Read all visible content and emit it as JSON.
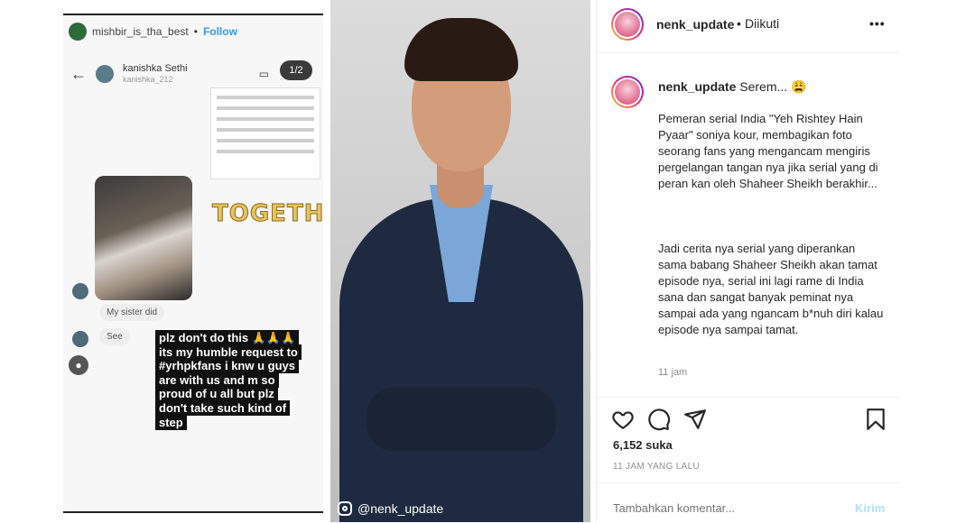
{
  "story": {
    "username": "mishbir_is_tha_best",
    "follow": "Follow",
    "dm_name": "kanishka Sethi",
    "dm_handle": "kanishka_212",
    "pager": "1/2",
    "sticker": "TOGETHER",
    "bubble1": "My sister did",
    "bubble2": "See",
    "caption": [
      "plz don't do this 🙏🙏🙏",
      "its my humble request to",
      "#yrhpkfans i knw u guys",
      "are with us and m so",
      "proud of u all but plz",
      "don't take such kind of",
      "step"
    ]
  },
  "watermark": "@nenk_update",
  "post": {
    "author": "nenk_update",
    "following": "Diikuti",
    "more": "•••",
    "caption_user": "nenk_update",
    "caption_head": "Serem... 😩",
    "paragraph1": "Pemeran serial India \"Yeh Rishtey Hain Pyaar\" soniya kour, membagikan foto seorang fans yang mengancam mengiris pergelangan tangan nya jika serial yang di peran kan oleh Shaheer Sheikh berakhir...",
    "paragraph2": "Jadi cerita nya serial yang diperankan sama babang Shaheer Sheikh akan tamat episode nya, serial ini lagi rame di India sana dan sangat banyak peminat nya sampai ada yang ngancam b*nuh diri kalau episode nya sampai tamat.",
    "comment_time": "11 jam",
    "likes": "6,152 suka",
    "posted": "11 JAM YANG LALU",
    "comment_placeholder": "Tambahkan komentar...",
    "post_button": "Kirim"
  },
  "icons": [
    "heart-icon",
    "comment-icon",
    "share-icon",
    "bookmark-icon",
    "instagram-icon",
    "back-arrow-icon",
    "video-icon",
    "flag-icon"
  ]
}
